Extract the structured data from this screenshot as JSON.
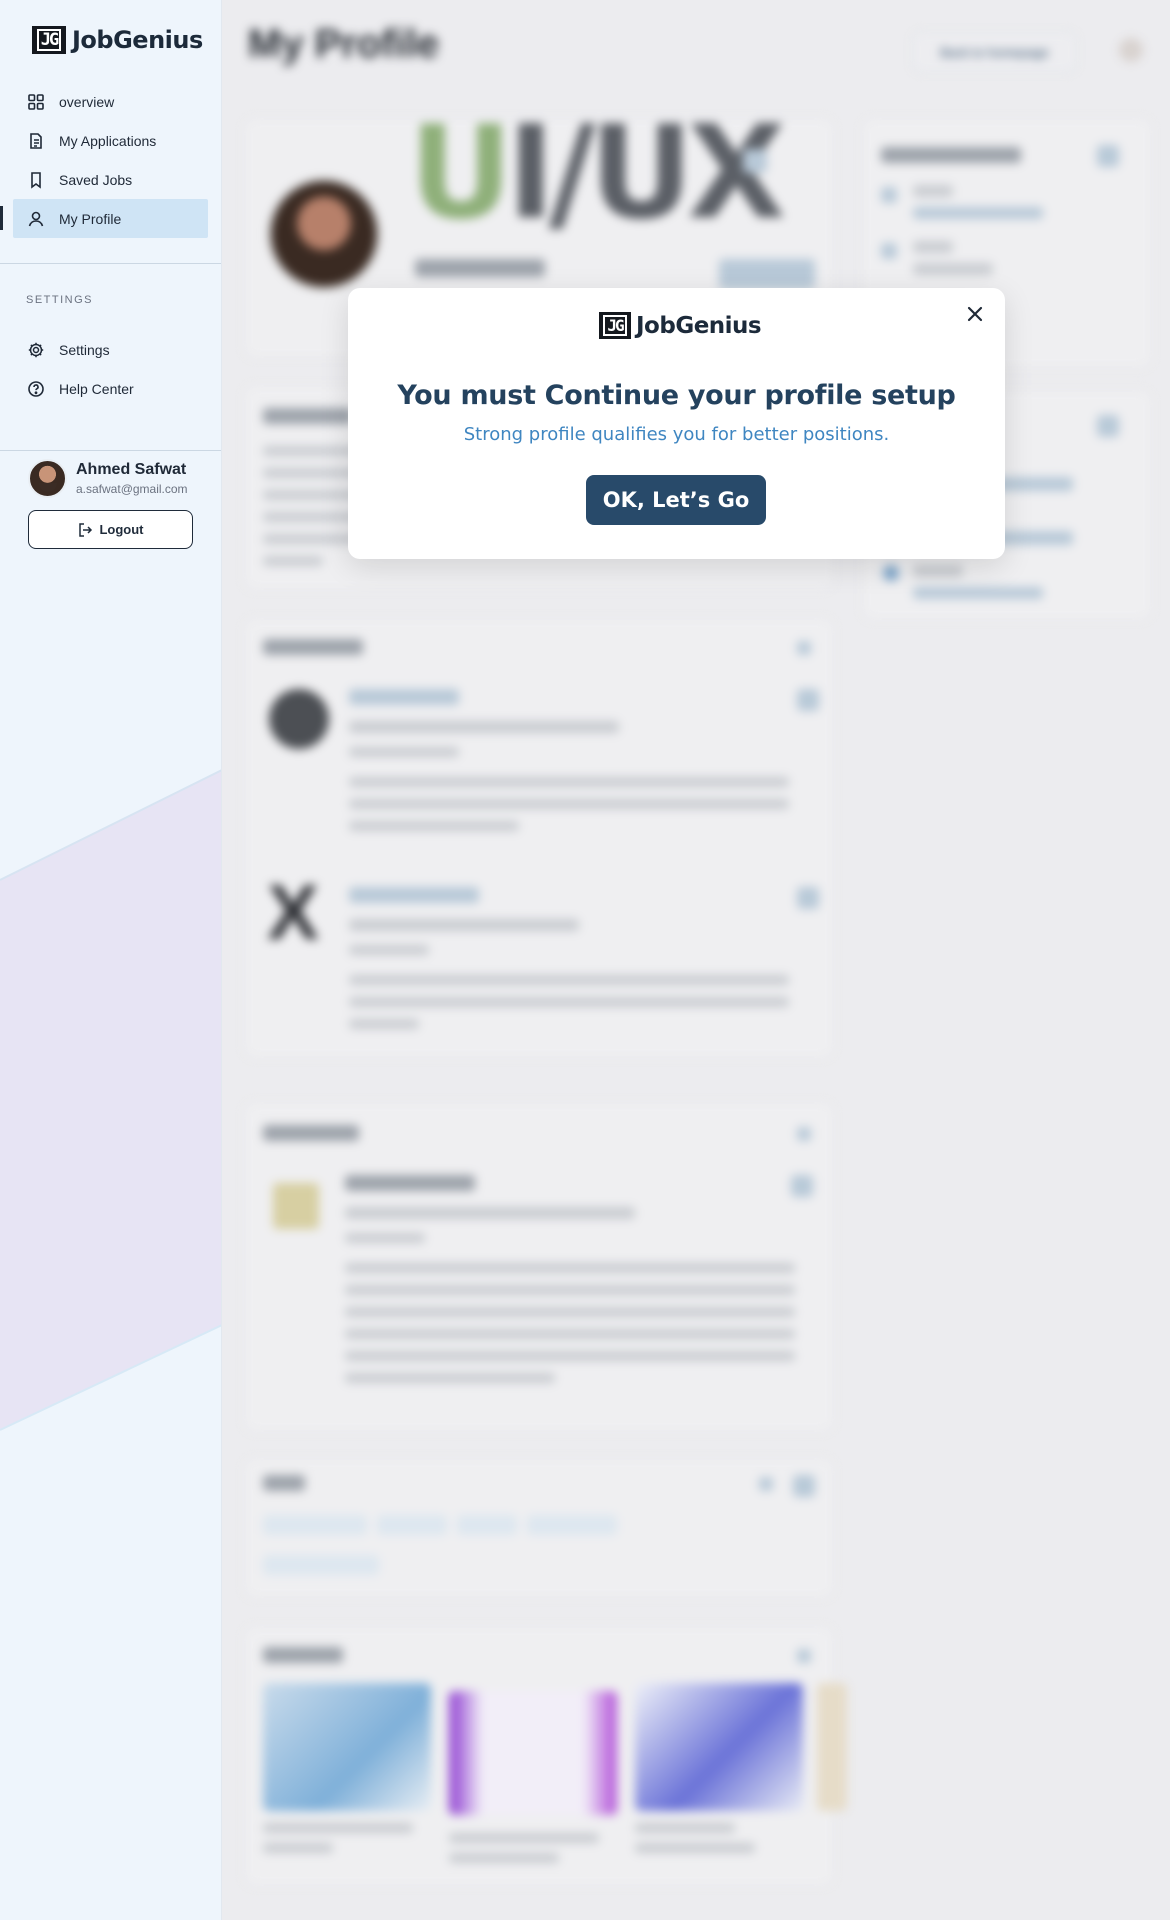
{
  "brand": {
    "name": "JobGenius",
    "mark": "JG"
  },
  "sidebar": {
    "nav": [
      {
        "label": "overview",
        "icon": "grid-icon"
      },
      {
        "label": "My Applications",
        "icon": "document-icon"
      },
      {
        "label": "Saved Jobs",
        "icon": "bookmark-icon"
      },
      {
        "label": "My Profile",
        "icon": "user-icon",
        "active": true
      }
    ],
    "section_label": "SETTINGS",
    "settings": [
      {
        "label": "Settings",
        "icon": "gear-icon"
      },
      {
        "label": "Help Center",
        "icon": "help-circle-icon"
      }
    ],
    "user": {
      "name": "Ahmed Safwat",
      "email": "a.safwat@gmail.com"
    },
    "logout_label": "Logout"
  },
  "main": {
    "title": "My Profile",
    "back_label": "Back to homepage",
    "profile_banner_text": "UI/UX"
  },
  "modal": {
    "title": "You must Continue your profile setup",
    "subtitle": "Strong profile qualifies you for better positions.",
    "button_label": "OK, Let’s Go"
  },
  "colors": {
    "accent": "#284a6a",
    "subtitle": "#3f86c1",
    "sidebar_active": "#cfe4f5"
  }
}
